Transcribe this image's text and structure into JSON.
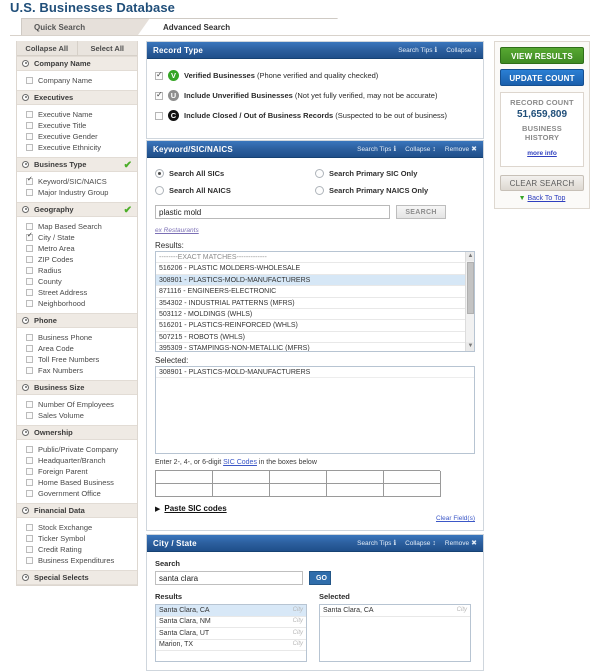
{
  "page": {
    "title": "U.S. Businesses Database"
  },
  "tabs": [
    {
      "label": "Quick Search",
      "active": false
    },
    {
      "label": "Advanced Search",
      "active": true
    }
  ],
  "sidebar": {
    "collapse_all": "Collapse All",
    "select_all": "Select All",
    "sections": [
      {
        "label": "Company Name",
        "checked": false,
        "items": [
          {
            "label": "Company Name",
            "checked": false
          }
        ]
      },
      {
        "label": "Executives",
        "checked": false,
        "items": [
          {
            "label": "Executive Name",
            "checked": false
          },
          {
            "label": "Executive Title",
            "checked": false
          },
          {
            "label": "Executive Gender",
            "checked": false
          },
          {
            "label": "Executive Ethnicity",
            "checked": false
          }
        ]
      },
      {
        "label": "Business Type",
        "checked": true,
        "items": [
          {
            "label": "Keyword/SIC/NAICS",
            "checked": true
          },
          {
            "label": "Major Industry Group",
            "checked": false
          }
        ]
      },
      {
        "label": "Geography",
        "checked": true,
        "items": [
          {
            "label": "Map Based Search",
            "checked": false
          },
          {
            "label": "City / State",
            "checked": true
          },
          {
            "label": "Metro Area",
            "checked": false
          },
          {
            "label": "ZIP Codes",
            "checked": false
          },
          {
            "label": "Radius",
            "checked": false
          },
          {
            "label": "County",
            "checked": false
          },
          {
            "label": "Street Address",
            "checked": false
          },
          {
            "label": "Neighborhood",
            "checked": false
          }
        ]
      },
      {
        "label": "Phone",
        "checked": false,
        "items": [
          {
            "label": "Business Phone",
            "checked": false
          },
          {
            "label": "Area Code",
            "checked": false
          },
          {
            "label": "Toll Free Numbers",
            "checked": false
          },
          {
            "label": "Fax Numbers",
            "checked": false
          }
        ]
      },
      {
        "label": "Business Size",
        "checked": false,
        "items": [
          {
            "label": "Number Of Employees",
            "checked": false
          },
          {
            "label": "Sales Volume",
            "checked": false
          }
        ]
      },
      {
        "label": "Ownership",
        "checked": false,
        "items": [
          {
            "label": "Public/Private Company",
            "checked": false
          },
          {
            "label": "Headquarter/Branch",
            "checked": false
          },
          {
            "label": "Foreign Parent",
            "checked": false
          },
          {
            "label": "Home Based Business",
            "checked": false
          },
          {
            "label": "Government Office",
            "checked": false
          }
        ]
      },
      {
        "label": "Financial Data",
        "checked": false,
        "items": [
          {
            "label": "Stock Exchange",
            "checked": false
          },
          {
            "label": "Ticker Symbol",
            "checked": false
          },
          {
            "label": "Credit Rating",
            "checked": false
          },
          {
            "label": "Business Expenditures",
            "checked": false
          }
        ]
      },
      {
        "label": "Special Selects",
        "checked": false,
        "items": []
      }
    ]
  },
  "record_type": {
    "title": "Record Type",
    "search_tips": "Search Tips",
    "collapse": "Collapse",
    "rows": [
      {
        "checked": true,
        "badge": "V",
        "badge_kind": "verified-badge-icon",
        "label": "Verified Businesses",
        "note": "(Phone verified and quality checked)"
      },
      {
        "checked": true,
        "badge": "U",
        "badge_kind": "unverified-badge-icon",
        "label": "Include Unverified Businesses",
        "note": "(Not yet fully verified, may not be accurate)"
      },
      {
        "checked": false,
        "badge": "C",
        "badge_kind": "closed-badge-icon",
        "label": "Include Closed / Out of Business Records",
        "note": "(Suspected to be out of business)"
      }
    ]
  },
  "keyword_panel": {
    "title": "Keyword/SIC/NAICS",
    "search_tips": "Search Tips",
    "collapse": "Collapse",
    "remove": "Remove",
    "radios": [
      {
        "label": "Search All SICs",
        "selected": true
      },
      {
        "label": "Search Primary SIC Only",
        "selected": false
      },
      {
        "label": "Search All NAICS",
        "selected": false
      },
      {
        "label": "Search Primary NAICS Only",
        "selected": false
      }
    ],
    "search_value": "plastic mold",
    "search_placeholder": "",
    "search_button": "SEARCH",
    "example_link": "ex Restaurants",
    "results_label": "Results:",
    "results_header": "--------EXACT MATCHES-------------",
    "results": [
      {
        "text": "516206 - PLASTIC MOLDERS-WHOLESALE",
        "selected": false
      },
      {
        "text": "308901 - PLASTICS-MOLD-MANUFACTURERS",
        "selected": true
      },
      {
        "text": "871116 - ENGINEERS-ELECTRONIC",
        "selected": false
      },
      {
        "text": "354302 - INDUSTRIAL PATTERNS (MFRS)",
        "selected": false
      },
      {
        "text": "503112 - MOLDINGS (WHLS)",
        "selected": false
      },
      {
        "text": "516201 - PLASTICS-REINFORCED (WHLS)",
        "selected": false
      },
      {
        "text": "507215 - ROBOTS (WHLS)",
        "selected": false
      },
      {
        "text": "395309 - STAMPINGS-NON-METALLIC (MFRS)",
        "selected": false
      }
    ],
    "selected_label": "Selected:",
    "selected": [
      "308901 - PLASTICS-MOLD-MANUFACTURERS"
    ],
    "hint_prefix": "Enter 2-, 4-, or 6-digit ",
    "hint_link": "SIC Codes",
    "hint_suffix": " in the boxes below",
    "sic_cells": [
      "",
      "",
      "",
      "",
      "",
      "",
      "",
      "",
      "",
      ""
    ],
    "paste_label": "Paste SIC codes",
    "clear_fields": "Clear Field(s)"
  },
  "city_state_panel": {
    "title": "City / State",
    "search_tips": "Search Tips",
    "collapse": "Collapse",
    "remove": "Remove",
    "search_label": "Search",
    "search_value": "santa clara",
    "go_button": "GO",
    "results_label": "Results",
    "selected_label": "Selected",
    "results": [
      {
        "text": "Santa Clara, CA",
        "tag": "City",
        "selected": true
      },
      {
        "text": "Santa Clara, NM",
        "tag": "City",
        "selected": false
      },
      {
        "text": "Santa Clara, UT",
        "tag": "City",
        "selected": false
      },
      {
        "text": "Marion, TX",
        "tag": "City",
        "selected": false
      }
    ],
    "selected": [
      {
        "text": "Santa Clara, CA",
        "tag": "City"
      }
    ]
  },
  "rail": {
    "view_results": "VIEW RESULTS",
    "update_count": "UPDATE COUNT",
    "record_count_label": "RECORD COUNT",
    "record_count_value": "51,659,809",
    "business_history_label": "BUSINESS HISTORY",
    "more_info": "more info",
    "clear_search": "CLEAR SEARCH",
    "back_to_top": "Back To Top"
  },
  "colors": {
    "accent_blue": "#2c5f9e",
    "green": "#4cae29",
    "title_blue": "#1f4e79",
    "link_blue": "#2f3fbf",
    "selected_row": "#d6e7f6"
  }
}
